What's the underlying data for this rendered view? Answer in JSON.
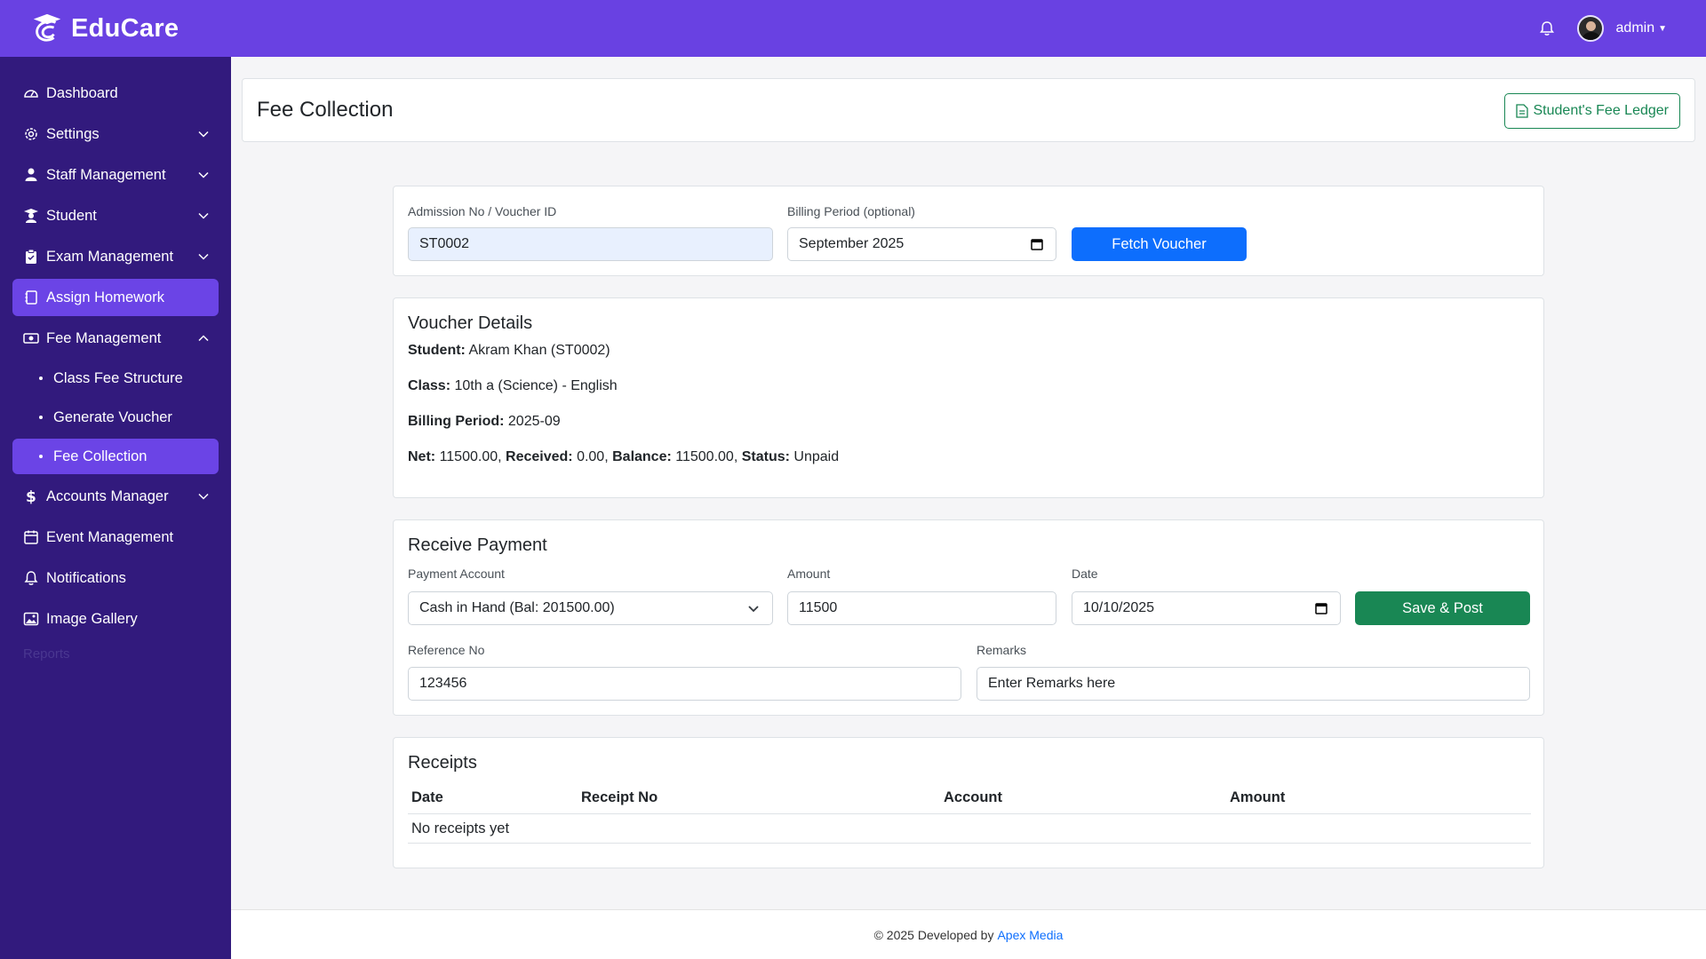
{
  "app": {
    "brand": "EduCare"
  },
  "topbar": {
    "user_name": "admin"
  },
  "sidebar": {
    "items": [
      {
        "label": "Dashboard",
        "icon": "dashboard-gauge-icon"
      },
      {
        "label": "Settings",
        "icon": "gear-icon",
        "expandable": true
      },
      {
        "label": "Staff Management",
        "icon": "person-icon",
        "expandable": true
      },
      {
        "label": "Student",
        "icon": "graduate-icon",
        "expandable": true
      },
      {
        "label": "Exam Management",
        "icon": "clipboard-icon",
        "expandable": true
      },
      {
        "label": "Assign Homework",
        "icon": "journal-icon"
      },
      {
        "label": "Fee Management",
        "icon": "cash-icon",
        "expanded": true
      },
      {
        "label": "Accounts Manager",
        "icon": "dollar-icon",
        "expandable": true
      },
      {
        "label": "Event Management",
        "icon": "calendar-icon"
      },
      {
        "label": "Notifications",
        "icon": "bell-icon"
      },
      {
        "label": "Image Gallery",
        "icon": "image-icon"
      }
    ],
    "sub_items": [
      {
        "label": "Class Fee Structure"
      },
      {
        "label": "Generate Voucher"
      },
      {
        "label": "Fee Collection",
        "active": true
      }
    ],
    "faded_text": "Reports"
  },
  "header": {
    "title": "Fee Collection",
    "ledger_button": "Student's Fee Ledger"
  },
  "fetch": {
    "admission_label": "Admission No / Voucher ID",
    "admission_value": "ST0002",
    "billing_label": "Billing Period (optional)",
    "billing_value": "September 2025",
    "button": "Fetch Voucher"
  },
  "voucher": {
    "title": "Voucher Details",
    "student_label": "Student:",
    "student_value": "Akram Khan (ST0002)",
    "class_label": "Class:",
    "class_value": "10th a (Science) - English",
    "billing_label": "Billing Period:",
    "billing_value": "2025-09",
    "net_label": "Net:",
    "net_value": "11500.00,",
    "received_label": "Received:",
    "received_value": "0.00,",
    "balance_label": "Balance:",
    "balance_value": "11500.00,",
    "status_label": "Status:",
    "status_value": "Unpaid"
  },
  "payment": {
    "title": "Receive Payment",
    "account_label": "Payment Account",
    "account_value": "Cash in Hand (Bal: 201500.00)",
    "amount_label": "Amount",
    "amount_value": "11500",
    "date_label": "Date",
    "date_value": "10/10/2025",
    "save_button": "Save & Post",
    "reference_label": "Reference No",
    "reference_value": "123456",
    "remarks_label": "Remarks",
    "remarks_placeholder": "Enter Remarks here"
  },
  "receipts": {
    "title": "Receipts",
    "columns": [
      "Date",
      "Receipt No",
      "Account",
      "Amount"
    ],
    "empty_text": "No receipts yet"
  },
  "footer": {
    "text": "© 2025 Developed by",
    "link": "Apex Media"
  },
  "colors": {
    "brand": "#6941e2",
    "sidebar": "#321a7d",
    "active": "#6b44e6",
    "primary": "#0d6efd",
    "success": "#198754"
  }
}
